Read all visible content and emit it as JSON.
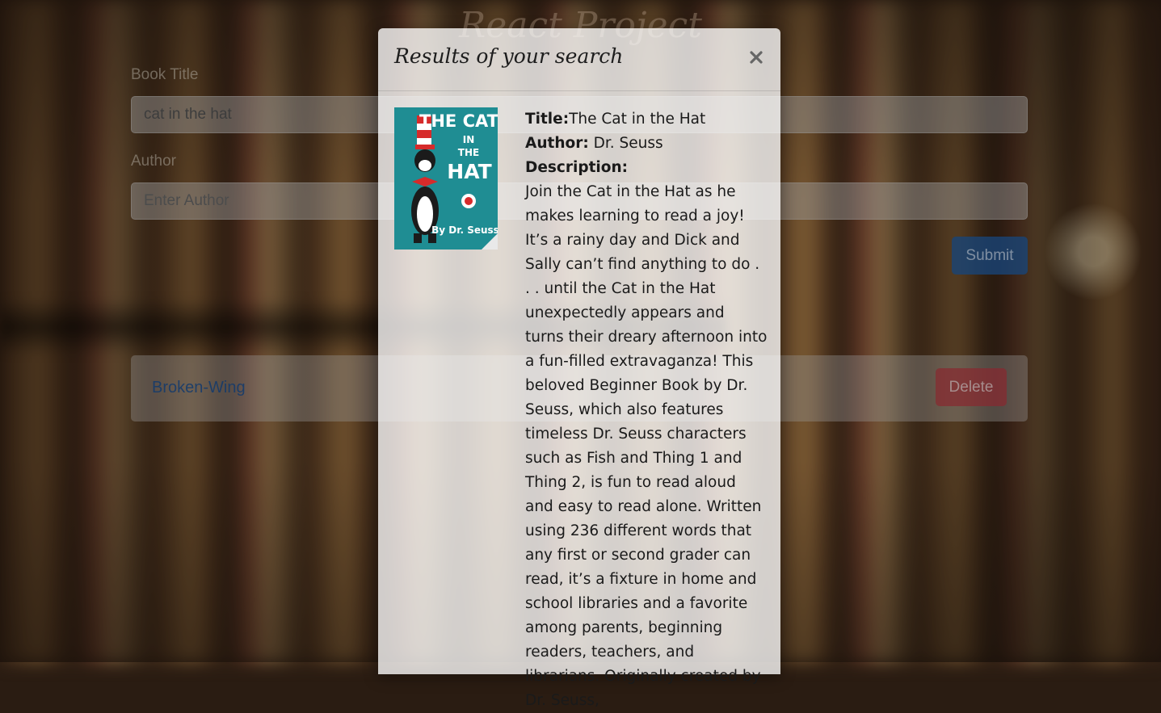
{
  "app": {
    "title": "React Project"
  },
  "form": {
    "book_title_label": "Book Title",
    "book_title_value": "cat in the hat",
    "author_label": "Author",
    "author_placeholder": "Enter Author",
    "submit_label": "Submit"
  },
  "saved_books": {
    "items": [
      {
        "title": "Broken-Wing",
        "delete_label": "Delete"
      }
    ]
  },
  "modal": {
    "header": "Results of your search",
    "close_icon": "close-icon",
    "result": {
      "title_label": "Title:",
      "title": "The Cat in the Hat",
      "author_label": "Author:",
      "author": "Dr. Seuss",
      "description_label": "Description:",
      "description": "Join the Cat in the Hat as he makes learning to read a joy! It’s a rainy day and Dick and Sally can’t find anything to do . . . until the Cat in the Hat unexpectedly appears and turns their dreary afternoon into a fun-filled extravaganza! This beloved Beginner Book by Dr. Seuss, which also features timeless Dr. Seuss characters such as Fish and Thing 1 and Thing 2, is fun to read aloud and easy to read alone. Written using 236 different words that any first or second grader can read, it’s a fixture in home and school libraries and a favorite among parents, beginning readers, teachers, and librarians. Originally created by Dr. Seuss,",
      "cover": {
        "line1": "THE CAT",
        "line2": "IN",
        "line3": "THE",
        "line4": "HAT",
        "author": "By Dr. Seuss"
      }
    }
  },
  "colors": {
    "primary": "#235fa5",
    "danger": "#be3741",
    "cover_teal": "#1f8d93"
  }
}
